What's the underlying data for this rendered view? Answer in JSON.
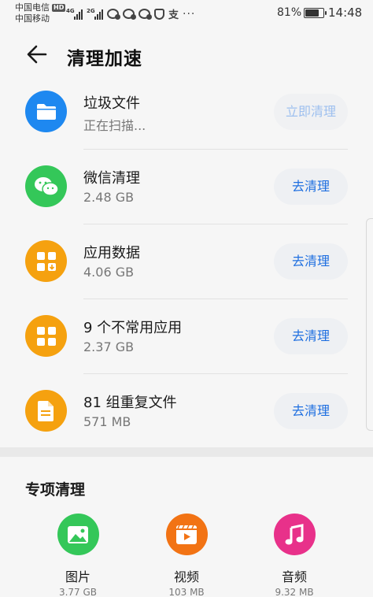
{
  "status_bar": {
    "carrier_1": "中国电信",
    "carrier_1_badge": "HD",
    "carrier_2": "中国移动",
    "sim1_generation": "4G",
    "sim2_generation": "2G",
    "notification_text_icon": "支",
    "more_icon": "···",
    "battery_percent": "81%",
    "battery_level": 0.81,
    "time": "14:48"
  },
  "header": {
    "title": "清理加速"
  },
  "items": [
    {
      "title": "垃圾文件",
      "subtitle": "正在扫描...",
      "action": "立即清理",
      "icon": "folder-icon",
      "color": "#1e88f0",
      "disabled": true
    },
    {
      "title": "微信清理",
      "subtitle": "2.48 GB",
      "action": "去清理",
      "icon": "wechat-icon",
      "color": "#34c759",
      "disabled": false
    },
    {
      "title": "应用数据",
      "subtitle": "4.06 GB",
      "action": "去清理",
      "icon": "app-data-icon",
      "color": "#f5a10f",
      "disabled": false
    },
    {
      "title": "9 个不常用应用",
      "subtitle": "2.37 GB",
      "action": "去清理",
      "icon": "apps-grid-icon",
      "color": "#f5a10f",
      "disabled": false
    },
    {
      "title": "81 组重复文件",
      "subtitle": "571 MB",
      "action": "去清理",
      "icon": "duplicate-file-icon",
      "color": "#f5a10f",
      "disabled": false
    }
  ],
  "special": {
    "title": "专项清理",
    "items": [
      {
        "label": "图片",
        "size": "3.77 GB",
        "icon": "image-icon",
        "color": "#34c759"
      },
      {
        "label": "视频",
        "size": "103 MB",
        "icon": "video-icon",
        "color": "#f27314"
      },
      {
        "label": "音频",
        "size": "9.32 MB",
        "icon": "music-icon",
        "color": "#e8318a"
      }
    ]
  }
}
